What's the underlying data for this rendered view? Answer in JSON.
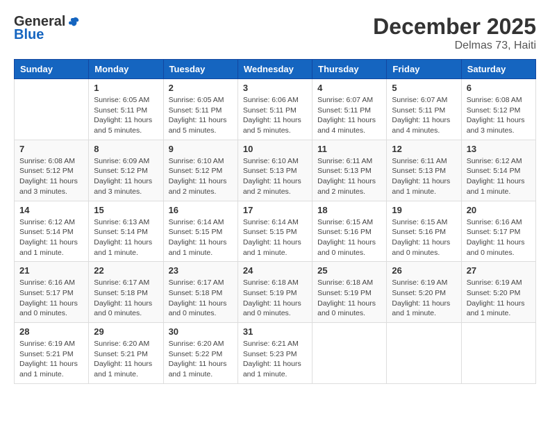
{
  "header": {
    "logo_general": "General",
    "logo_blue": "Blue",
    "title": "December 2025",
    "subtitle": "Delmas 73, Haiti"
  },
  "calendar": {
    "columns": [
      "Sunday",
      "Monday",
      "Tuesday",
      "Wednesday",
      "Thursday",
      "Friday",
      "Saturday"
    ],
    "weeks": [
      [
        {
          "day": "",
          "sunrise": "",
          "sunset": "",
          "daylight": ""
        },
        {
          "day": "1",
          "sunrise": "6:05 AM",
          "sunset": "5:11 PM",
          "daylight": "11 hours and 5 minutes."
        },
        {
          "day": "2",
          "sunrise": "6:05 AM",
          "sunset": "5:11 PM",
          "daylight": "11 hours and 5 minutes."
        },
        {
          "day": "3",
          "sunrise": "6:06 AM",
          "sunset": "5:11 PM",
          "daylight": "11 hours and 5 minutes."
        },
        {
          "day": "4",
          "sunrise": "6:07 AM",
          "sunset": "5:11 PM",
          "daylight": "11 hours and 4 minutes."
        },
        {
          "day": "5",
          "sunrise": "6:07 AM",
          "sunset": "5:11 PM",
          "daylight": "11 hours and 4 minutes."
        },
        {
          "day": "6",
          "sunrise": "6:08 AM",
          "sunset": "5:12 PM",
          "daylight": "11 hours and 3 minutes."
        }
      ],
      [
        {
          "day": "7",
          "sunrise": "6:08 AM",
          "sunset": "5:12 PM",
          "daylight": "11 hours and 3 minutes."
        },
        {
          "day": "8",
          "sunrise": "6:09 AM",
          "sunset": "5:12 PM",
          "daylight": "11 hours and 3 minutes."
        },
        {
          "day": "9",
          "sunrise": "6:10 AM",
          "sunset": "5:12 PM",
          "daylight": "11 hours and 2 minutes."
        },
        {
          "day": "10",
          "sunrise": "6:10 AM",
          "sunset": "5:13 PM",
          "daylight": "11 hours and 2 minutes."
        },
        {
          "day": "11",
          "sunrise": "6:11 AM",
          "sunset": "5:13 PM",
          "daylight": "11 hours and 2 minutes."
        },
        {
          "day": "12",
          "sunrise": "6:11 AM",
          "sunset": "5:13 PM",
          "daylight": "11 hours and 1 minute."
        },
        {
          "day": "13",
          "sunrise": "6:12 AM",
          "sunset": "5:14 PM",
          "daylight": "11 hours and 1 minute."
        }
      ],
      [
        {
          "day": "14",
          "sunrise": "6:12 AM",
          "sunset": "5:14 PM",
          "daylight": "11 hours and 1 minute."
        },
        {
          "day": "15",
          "sunrise": "6:13 AM",
          "sunset": "5:14 PM",
          "daylight": "11 hours and 1 minute."
        },
        {
          "day": "16",
          "sunrise": "6:14 AM",
          "sunset": "5:15 PM",
          "daylight": "11 hours and 1 minute."
        },
        {
          "day": "17",
          "sunrise": "6:14 AM",
          "sunset": "5:15 PM",
          "daylight": "11 hours and 1 minute."
        },
        {
          "day": "18",
          "sunrise": "6:15 AM",
          "sunset": "5:16 PM",
          "daylight": "11 hours and 0 minutes."
        },
        {
          "day": "19",
          "sunrise": "6:15 AM",
          "sunset": "5:16 PM",
          "daylight": "11 hours and 0 minutes."
        },
        {
          "day": "20",
          "sunrise": "6:16 AM",
          "sunset": "5:17 PM",
          "daylight": "11 hours and 0 minutes."
        }
      ],
      [
        {
          "day": "21",
          "sunrise": "6:16 AM",
          "sunset": "5:17 PM",
          "daylight": "11 hours and 0 minutes."
        },
        {
          "day": "22",
          "sunrise": "6:17 AM",
          "sunset": "5:18 PM",
          "daylight": "11 hours and 0 minutes."
        },
        {
          "day": "23",
          "sunrise": "6:17 AM",
          "sunset": "5:18 PM",
          "daylight": "11 hours and 0 minutes."
        },
        {
          "day": "24",
          "sunrise": "6:18 AM",
          "sunset": "5:19 PM",
          "daylight": "11 hours and 0 minutes."
        },
        {
          "day": "25",
          "sunrise": "6:18 AM",
          "sunset": "5:19 PM",
          "daylight": "11 hours and 0 minutes."
        },
        {
          "day": "26",
          "sunrise": "6:19 AM",
          "sunset": "5:20 PM",
          "daylight": "11 hours and 1 minute."
        },
        {
          "day": "27",
          "sunrise": "6:19 AM",
          "sunset": "5:20 PM",
          "daylight": "11 hours and 1 minute."
        }
      ],
      [
        {
          "day": "28",
          "sunrise": "6:19 AM",
          "sunset": "5:21 PM",
          "daylight": "11 hours and 1 minute."
        },
        {
          "day": "29",
          "sunrise": "6:20 AM",
          "sunset": "5:21 PM",
          "daylight": "11 hours and 1 minute."
        },
        {
          "day": "30",
          "sunrise": "6:20 AM",
          "sunset": "5:22 PM",
          "daylight": "11 hours and 1 minute."
        },
        {
          "day": "31",
          "sunrise": "6:21 AM",
          "sunset": "5:23 PM",
          "daylight": "11 hours and 1 minute."
        },
        {
          "day": "",
          "sunrise": "",
          "sunset": "",
          "daylight": ""
        },
        {
          "day": "",
          "sunrise": "",
          "sunset": "",
          "daylight": ""
        },
        {
          "day": "",
          "sunrise": "",
          "sunset": "",
          "daylight": ""
        }
      ]
    ],
    "labels": {
      "sunrise_prefix": "Sunrise: ",
      "sunset_prefix": "Sunset: ",
      "daylight_prefix": "Daylight: "
    }
  }
}
